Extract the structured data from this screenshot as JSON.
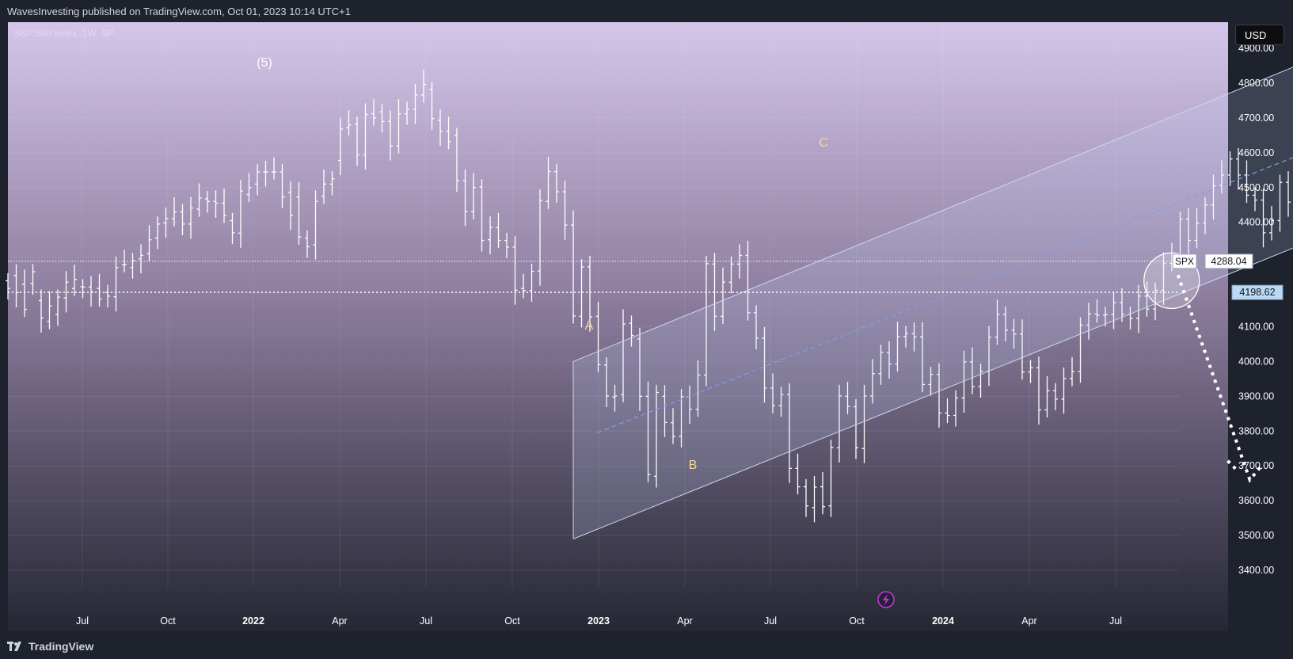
{
  "header": {
    "publisher_line": "WavesInvesting published on TradingView.com, Oct 01, 2023 10:14 UTC+1"
  },
  "footer": {
    "brand": "TradingView"
  },
  "toolbar": {
    "currency": "USD"
  },
  "symbol": {
    "legend": "S&P 500 index, 1W, SP",
    "ticker": "SPX",
    "last_price": "4288.04",
    "crosshair_price": "4198.62"
  },
  "labels": {
    "wave5": "(5)",
    "waveA": "A",
    "waveB": "B",
    "waveC": "C"
  },
  "chart_data": {
    "type": "ohlc",
    "interval": "1W",
    "title": "S&P 500 index, 1W, SP",
    "ylim": [
      3350,
      4950
    ],
    "yticks": [
      3400,
      3500,
      3600,
      3700,
      3800,
      3900,
      4000,
      4100,
      4200,
      4300,
      4400,
      4500,
      4600,
      4700,
      4800,
      4900
    ],
    "xtick_labels": [
      "Jul",
      "Oct",
      "2022",
      "Apr",
      "Jul",
      "Oct",
      "2023",
      "Apr",
      "Jul",
      "Oct",
      "2024",
      "Apr",
      "Jul"
    ],
    "grid": true,
    "series": [
      {
        "name": "SPX",
        "values": [
          [
            4232,
            4210
          ],
          [
            4247,
            4198
          ],
          [
            4222,
            4150
          ],
          [
            4224,
            4258
          ],
          [
            4175,
            4125
          ],
          [
            4115,
            4160
          ],
          [
            4135,
            4185
          ],
          [
            4183,
            4228
          ],
          [
            4210,
            4236
          ],
          [
            4215,
            4214
          ],
          [
            4214,
            4200
          ],
          [
            4210,
            4180
          ],
          [
            4198,
            4188
          ],
          [
            4186,
            4270
          ],
          [
            4278,
            4279
          ],
          [
            4270,
            4290
          ],
          [
            4295,
            4305
          ],
          [
            4310,
            4350
          ],
          [
            4355,
            4395
          ],
          [
            4398,
            4411
          ],
          [
            4410,
            4430
          ],
          [
            4430,
            4395
          ],
          [
            4395,
            4441
          ],
          [
            4438,
            4470
          ],
          [
            4468,
            4460
          ],
          [
            4460,
            4455
          ],
          [
            4455,
            4420
          ],
          [
            4405,
            4370
          ],
          [
            4369,
            4490
          ],
          [
            4480,
            4500
          ],
          [
            4510,
            4545
          ],
          [
            4545,
            4545
          ],
          [
            4545,
            4545
          ],
          [
            4545,
            4473
          ],
          [
            4486,
            4420
          ],
          [
            4473,
            4358
          ],
          [
            4355,
            4330
          ],
          [
            4335,
            4460
          ],
          [
            4475,
            4510
          ],
          [
            4510,
            4525
          ],
          [
            4578,
            4668
          ],
          [
            4672,
            4680
          ],
          [
            4682,
            4594
          ],
          [
            4594,
            4710
          ],
          [
            4712,
            4700
          ],
          [
            4718,
            4690
          ],
          [
            4690,
            4620
          ],
          [
            4620,
            4712
          ],
          [
            4712,
            4725
          ],
          [
            4725,
            4766
          ],
          [
            4766,
            4796
          ],
          [
            4782,
            4698
          ],
          [
            4693,
            4662
          ],
          [
            4662,
            4632
          ],
          [
            4650,
            4520
          ],
          [
            4520,
            4431
          ],
          [
            4431,
            4500
          ],
          [
            4502,
            4348
          ],
          [
            4350,
            4385
          ],
          [
            4385,
            4348
          ],
          [
            4348,
            4329
          ],
          [
            4329,
            4205
          ],
          [
            4210,
            4204
          ],
          [
            4204,
            4259
          ],
          [
            4260,
            4463
          ],
          [
            4460,
            4546
          ],
          [
            4546,
            4488
          ],
          [
            4488,
            4392
          ],
          [
            4392,
            4131
          ],
          [
            4130,
            4272
          ],
          [
            4272,
            4128
          ],
          [
            4130,
            3991
          ],
          [
            3990,
            3901
          ],
          [
            3898,
            3901
          ],
          [
            3905,
            4108
          ],
          [
            4110,
            4075
          ],
          [
            4065,
            3900
          ],
          [
            3900,
            3675
          ],
          [
            3670,
            3911
          ],
          [
            3900,
            3825
          ],
          [
            3824,
            3785
          ],
          [
            3785,
            3899
          ],
          [
            3899,
            3863
          ],
          [
            3863,
            3961
          ],
          [
            3961,
            4281
          ],
          [
            4280,
            4130
          ],
          [
            4130,
            4228
          ],
          [
            4228,
            4280
          ],
          [
            4280,
            4305
          ],
          [
            4305,
            4140
          ],
          [
            4140,
            4067
          ],
          [
            4067,
            3924
          ],
          [
            3924,
            3873
          ],
          [
            3873,
            3905
          ],
          [
            3905,
            3693
          ],
          [
            3693,
            3640
          ],
          [
            3640,
            3585
          ],
          [
            3580,
            3639
          ],
          [
            3640,
            3583
          ],
          [
            3585,
            3753
          ],
          [
            3752,
            3901
          ],
          [
            3900,
            3871
          ],
          [
            3870,
            3752
          ],
          [
            3750,
            3901
          ],
          [
            3901,
            3965
          ],
          [
            3965,
            4026
          ],
          [
            4026,
            3993
          ],
          [
            3993,
            4072
          ],
          [
            4072,
            4080
          ],
          [
            4080,
            4071
          ],
          [
            4071,
            3934
          ],
          [
            3934,
            3963
          ],
          [
            3963,
            3852
          ],
          [
            3852,
            3845
          ],
          [
            3845,
            3895
          ],
          [
            3895,
            3999
          ],
          [
            3999,
            3928
          ],
          [
            3928,
            3972
          ],
          [
            3972,
            4070
          ],
          [
            4070,
            4136
          ],
          [
            4136,
            4090
          ],
          [
            4090,
            4079
          ],
          [
            4079,
            3970
          ],
          [
            3970,
            3982
          ],
          [
            3982,
            3861
          ],
          [
            3861,
            3916
          ],
          [
            3916,
            3892
          ],
          [
            3892,
            3951
          ],
          [
            3951,
            3971
          ],
          [
            3971,
            4105
          ],
          [
            4105,
            4137
          ],
          [
            4137,
            4133
          ],
          [
            4133,
            4135
          ],
          [
            4135,
            4169
          ],
          [
            4169,
            4136
          ],
          [
            4136,
            4124
          ],
          [
            4124,
            4188
          ],
          [
            4188,
            4151
          ],
          [
            4151,
            4205
          ],
          [
            4205,
            4282
          ],
          [
            4282,
            4299
          ],
          [
            4299,
            4409
          ],
          [
            4409,
            4348
          ],
          [
            4348,
            4398
          ],
          [
            4398,
            4450
          ],
          [
            4450,
            4505
          ],
          [
            4505,
            4536
          ],
          [
            4536,
            4582
          ],
          [
            4582,
            4536
          ],
          [
            4536,
            4478
          ],
          [
            4478,
            4464
          ],
          [
            4464,
            4370
          ],
          [
            4370,
            4405
          ],
          [
            4405,
            4515
          ],
          [
            4515,
            4458
          ],
          [
            4458,
            4450
          ],
          [
            4450,
            4320
          ],
          [
            4320,
            4288
          ]
        ]
      }
    ],
    "annotations": {
      "channel": {
        "upper_start": [
          68,
          4000
        ],
        "upper_end": [
          155,
          4850
        ],
        "lower_start": [
          68,
          3490
        ],
        "lower_end": [
          155,
          4330
        ]
      },
      "projection": [
        [
          141,
          4230
        ],
        [
          149,
          3660
        ],
        [
          150,
          3700
        ]
      ],
      "circle_center": [
        139.5,
        4230
      ]
    }
  },
  "style": {
    "bg_top": "#d4c6ea",
    "bg_bottom": "#252734",
    "bar_color": "#ffffff",
    "wave_color": "#f5d5a0",
    "axis_text": "#ffffff"
  }
}
